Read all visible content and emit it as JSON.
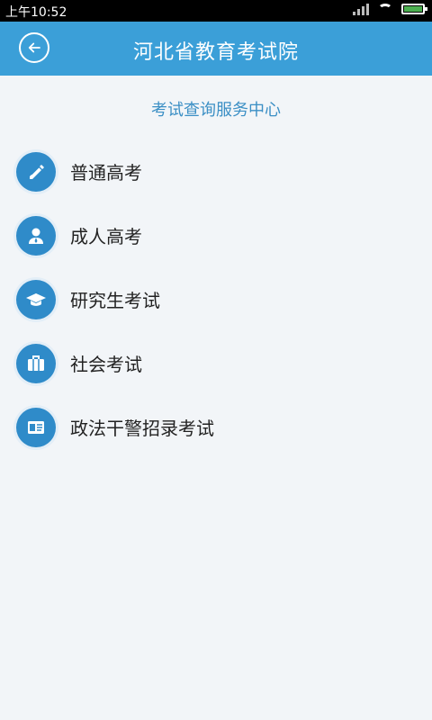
{
  "status": {
    "time": "上午10:52"
  },
  "header": {
    "title": "河北省教育考试院"
  },
  "subtitle": "考试查询服务中心",
  "items": [
    {
      "label": "普通高考",
      "icon": "pencil-icon"
    },
    {
      "label": "成人高考",
      "icon": "person-icon"
    },
    {
      "label": "研究生考试",
      "icon": "graduation-cap-icon"
    },
    {
      "label": "社会考试",
      "icon": "briefcase-icon"
    },
    {
      "label": "政法干警招录考试",
      "icon": "id-card-icon"
    }
  ],
  "colors": {
    "header": "#3b9fd8",
    "icon_bg": "#2f8bc9",
    "subtitle": "#3b8fc5",
    "background": "#f2f5f8"
  }
}
